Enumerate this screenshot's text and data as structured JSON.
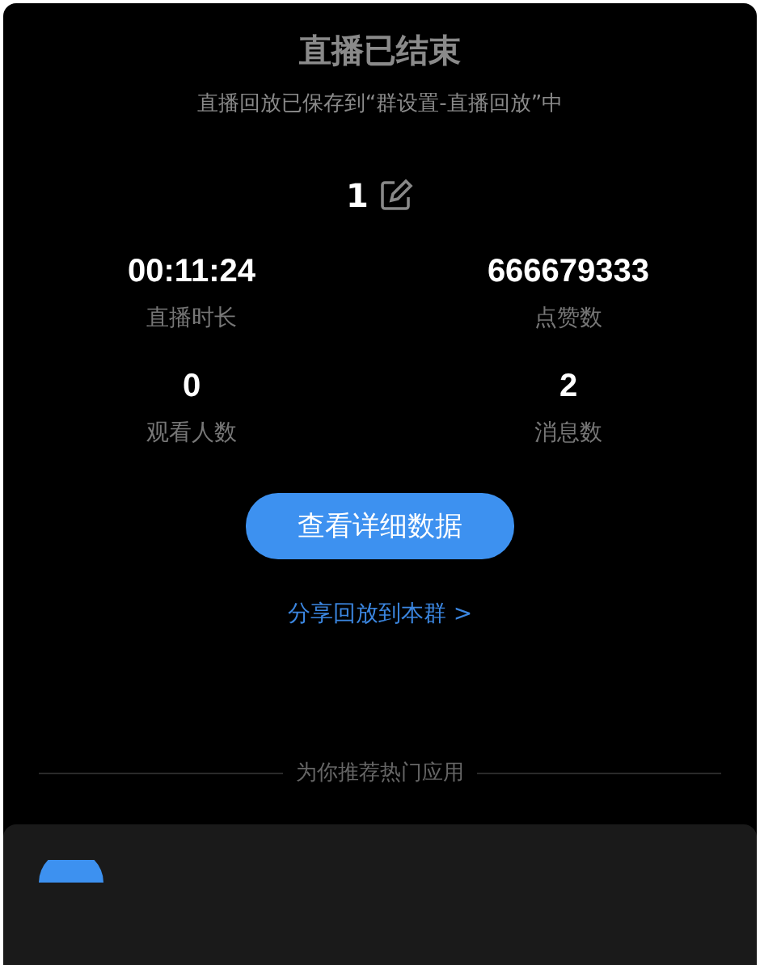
{
  "header": {
    "title": "直播已结束",
    "subtitle": "直播回放已保存到“群设置-直播回放”中"
  },
  "live_name": "1",
  "stats": [
    {
      "value": "00:11:24",
      "label": "直播时长"
    },
    {
      "value": "666679333",
      "label": "点赞数"
    },
    {
      "value": "0",
      "label": "观看人数"
    },
    {
      "value": "2",
      "label": "消息数"
    }
  ],
  "detail_button": "查看详细数据",
  "share_link": "分享回放到本群 >",
  "recommend": {
    "heading": "为你推荐热门应用"
  }
}
